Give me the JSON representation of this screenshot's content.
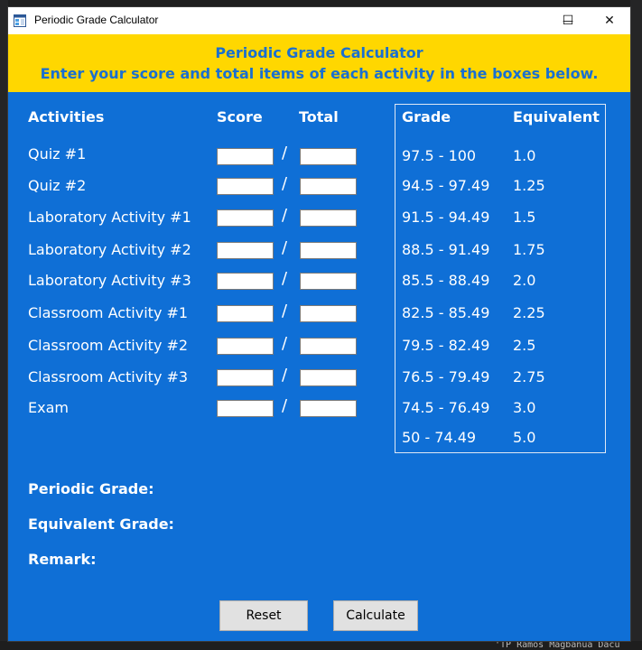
{
  "window": {
    "title": "Periodic Grade Calculator",
    "controls": {
      "minimize": "—",
      "maximize": "☐",
      "close": "✕"
    }
  },
  "banner": {
    "title": "Periodic Grade Calculator",
    "subtitle": "Enter your score and total items of each activity in the boxes below."
  },
  "headers": {
    "activities": "Activities",
    "score": "Score",
    "total": "Total",
    "grade": "Grade",
    "equivalent": "Equivalent"
  },
  "activities": [
    {
      "label": "Quiz #1",
      "score": "",
      "total": ""
    },
    {
      "label": "Quiz #2",
      "score": "",
      "total": ""
    },
    {
      "label": "Laboratory Activity #1",
      "score": "",
      "total": ""
    },
    {
      "label": "Laboratory Activity #2",
      "score": "",
      "total": ""
    },
    {
      "label": "Laboratory Activity #3",
      "score": "",
      "total": ""
    },
    {
      "label": "Classroom Activity #1",
      "score": "",
      "total": ""
    },
    {
      "label": "Classroom Activity #2",
      "score": "",
      "total": ""
    },
    {
      "label": "Classroom Activity #3",
      "score": "",
      "total": ""
    },
    {
      "label": "Exam",
      "score": "",
      "total": ""
    }
  ],
  "separator": "/",
  "grade_table": [
    {
      "range": "97.5 - 100",
      "equivalent": "1.0"
    },
    {
      "range": "94.5 - 97.49",
      "equivalent": "1.25"
    },
    {
      "range": "91.5 - 94.49",
      "equivalent": "1.5"
    },
    {
      "range": "88.5 - 91.49",
      "equivalent": "1.75"
    },
    {
      "range": "85.5 - 88.49",
      "equivalent": "2.0"
    },
    {
      "range": "82.5 - 85.49",
      "equivalent": "2.25"
    },
    {
      "range": "79.5 - 82.49",
      "equivalent": "2.5"
    },
    {
      "range": "76.5 - 79.49",
      "equivalent": "2.75"
    },
    {
      "range": "74.5 - 76.49",
      "equivalent": "3.0"
    },
    {
      "range": "50 - 74.49",
      "equivalent": "5.0"
    }
  ],
  "results": {
    "periodic_grade_label": "Periodic Grade:",
    "equivalent_grade_label": "Equivalent Grade:",
    "remark_label": "Remark:"
  },
  "buttons": {
    "reset": "Reset",
    "calculate": "Calculate"
  },
  "background_peek": "'TP Ramos Magbanua Dacu",
  "colors": {
    "window_bg": "#0f6fd6",
    "banner_bg": "#ffd700",
    "banner_text": "#1a6fd0",
    "text": "#ffffff"
  }
}
